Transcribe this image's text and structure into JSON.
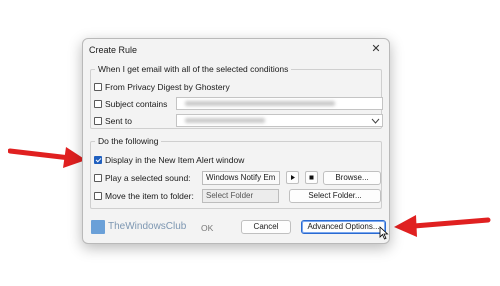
{
  "dialog": {
    "title": "Create Rule",
    "close_glyph": "✕"
  },
  "conditions": {
    "title": "When I get email with all of the selected conditions",
    "from_label": "From Privacy Digest by Ghostery",
    "subject_label": "Subject contains",
    "sent_to_label": "Sent to"
  },
  "actions": {
    "title": "Do the following",
    "display_label": "Display in the New Item Alert window",
    "play_sound_label": "Play a selected sound:",
    "sound_value": "Windows Notify Em",
    "browse_label": "Browse...",
    "move_label": "Move the item to folder:",
    "folder_placeholder": "Select Folder",
    "select_folder_label": "Select Folder..."
  },
  "footer": {
    "watermark": "TheWindowsClub",
    "ok_label": "OK",
    "cancel_label": "Cancel",
    "advanced_label": "Advanced Options..."
  },
  "icons": {
    "play": "play-icon",
    "stop": "stop-icon",
    "dropdown": "chevron-down-icon",
    "annotation": "red-arrow-icon"
  },
  "colors": {
    "accent": "#1f5fbf",
    "arrow": "#e02020"
  }
}
